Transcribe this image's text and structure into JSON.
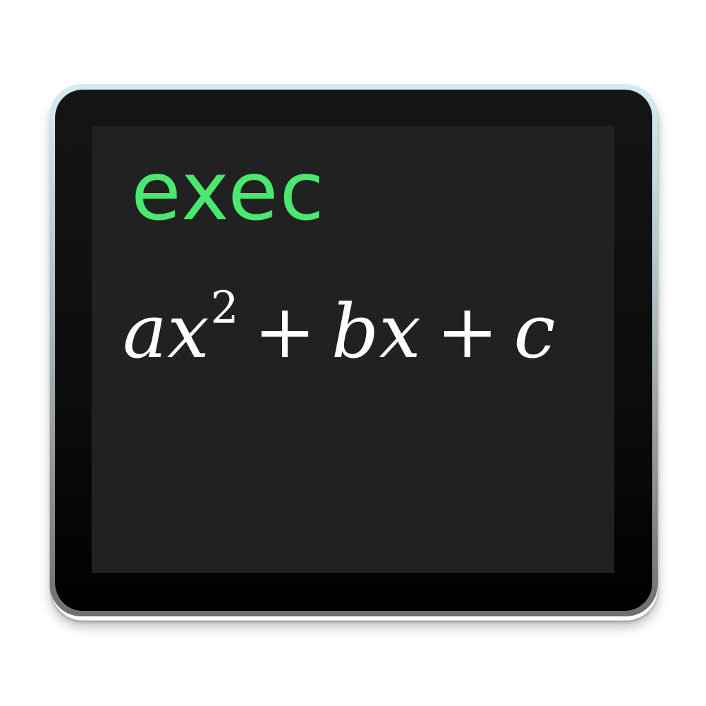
{
  "icon": {
    "name": "terminal-equation-icon",
    "colors": {
      "screen": "#212121",
      "command_text": "#4ae86e",
      "formula_text": "#ffffff",
      "bezel": "#0c0c0c"
    }
  },
  "screen": {
    "command": "exec",
    "formula": {
      "t1": "a",
      "t2": "x",
      "exp": "2",
      "op1": "+",
      "t3": "b",
      "t4": "x",
      "op2": "+",
      "t5": "c"
    }
  }
}
